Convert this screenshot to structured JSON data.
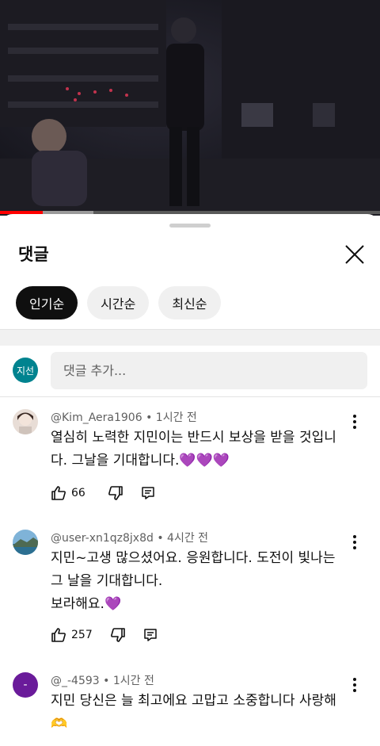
{
  "sheet": {
    "title": "댓글",
    "chips": [
      "인기순",
      "시간순",
      "최신순"
    ],
    "add_comment": {
      "avatar_text": "지선",
      "placeholder": "댓글 추가..."
    }
  },
  "comments": [
    {
      "author": "@Kim_Aera1906",
      "time": "1시간 전",
      "text": "열심히 노력한 지민이는 반드시 보상을 받을 것입니다. 그날을 기대합니다.💜💜💜",
      "likes": "66"
    },
    {
      "author": "@user-xn1qz8jx8d",
      "time": "4시간 전",
      "text": "지민~고생 많으셨어요. 응원합니다. 도전이 빛나는 그 날을 기대합니다.\n보라해요.💜",
      "likes": "257"
    },
    {
      "author": "@_-4593",
      "time": "1시간 전",
      "avatar_letter": "-",
      "text": "지민 당신은 늘 최고에요 고맙고 소중합니다 사랑해🫶"
    }
  ],
  "colors": {
    "progress": "#ff0000",
    "active_chip": "#0f0f0f",
    "my_avatar": "#00838f",
    "purple_avatar": "#6a1b9a"
  }
}
